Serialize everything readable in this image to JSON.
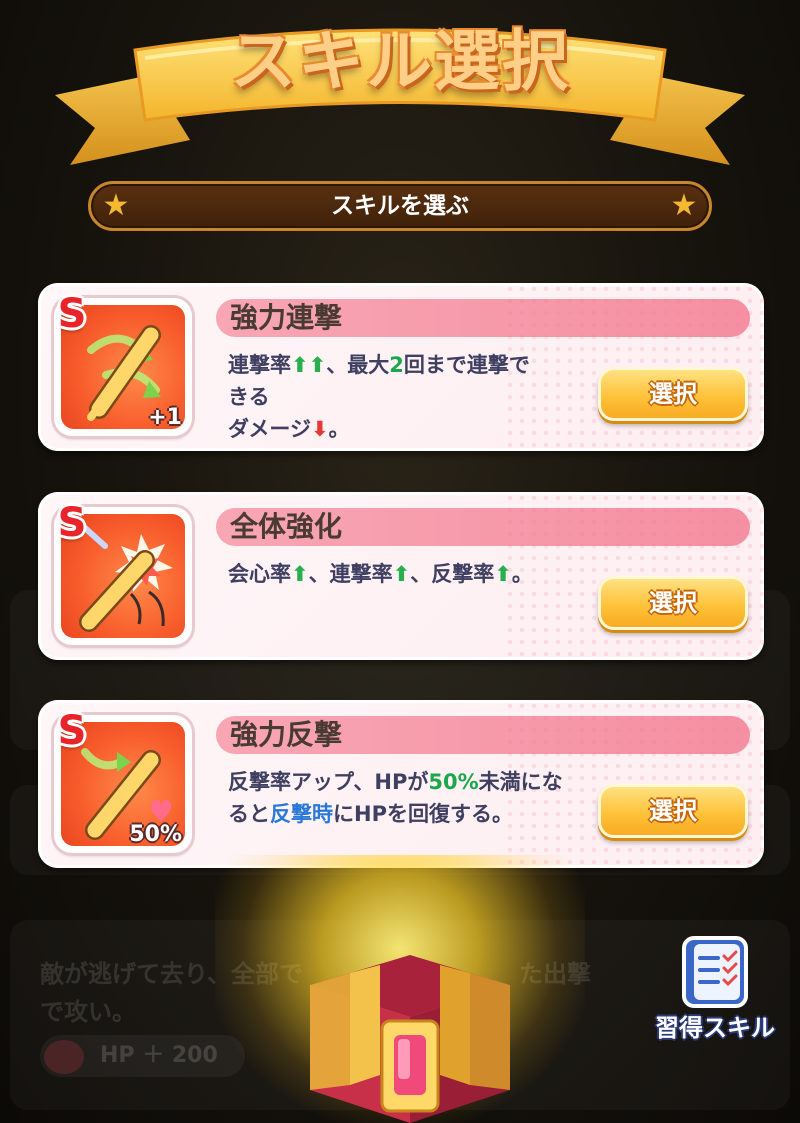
{
  "title": "スキル選択",
  "subtitle": "スキルを選ぶ",
  "skills": [
    {
      "rank": "S",
      "name": "強力連撃",
      "desc": [
        {
          "t": "連撃率"
        },
        {
          "t": "⬆⬆",
          "c": "up"
        },
        {
          "t": "、最大"
        },
        {
          "t": "2",
          "c": "hl-green"
        },
        {
          "t": "回まで連撃で"
        },
        {
          "t": "\nきる"
        },
        {
          "t": "\nダメージ"
        },
        {
          "t": "⬇",
          "c": "down"
        },
        {
          "t": "。"
        }
      ],
      "badge": "+1",
      "icon": "bat-double-hit-icon",
      "button": "選択"
    },
    {
      "rank": "S",
      "name": "全体強化",
      "desc": [
        {
          "t": "会心率"
        },
        {
          "t": "⬆",
          "c": "up"
        },
        {
          "t": "、連撃率"
        },
        {
          "t": "⬆",
          "c": "up"
        },
        {
          "t": "、反撃率"
        },
        {
          "t": "⬆",
          "c": "up"
        },
        {
          "t": "。"
        }
      ],
      "badge": "",
      "icon": "bat-power-up-icon",
      "button": "選択"
    },
    {
      "rank": "S",
      "name": "強力反撃",
      "desc": [
        {
          "t": "反撃率アップ、HPが"
        },
        {
          "t": "50%",
          "c": "hl-green"
        },
        {
          "t": "未満にな"
        },
        {
          "t": "\nると"
        },
        {
          "t": "反撃時",
          "c": "hl-blue"
        },
        {
          "t": "にHPを回復する。"
        }
      ],
      "badge": "50%",
      "icon": "bat-counter-heal-icon",
      "button": "選択"
    }
  ],
  "learned_skills_label": "習得スキル",
  "background_remnants": {
    "text": "敵が逃げて去り、全部で　　　　　　　　　た出撃で攻い。",
    "hp": "HP ＋ 200"
  },
  "colors": {
    "accent_gold": "#f5b930",
    "card_bg": "#fdeef1",
    "name_bar": "#f58fa1",
    "button": "#ffc23a",
    "icon_bg": "#f85d2c"
  }
}
